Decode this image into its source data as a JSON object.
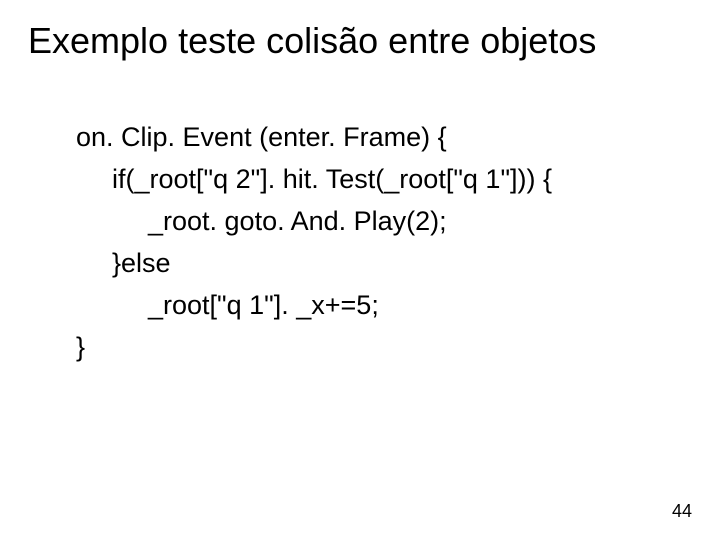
{
  "title": "Exemplo teste colisão entre objetos",
  "code": {
    "line1": "on. Clip. Event (enter. Frame) {",
    "line2": "if(_root[\"q 2\"]. hit. Test(_root[\"q 1\"])) {",
    "line3": "_root. goto. And. Play(2);",
    "line4": "}else",
    "line5": "_root[\"q 1\"]. _x+=5;",
    "line6": "}"
  },
  "page_number": "44"
}
